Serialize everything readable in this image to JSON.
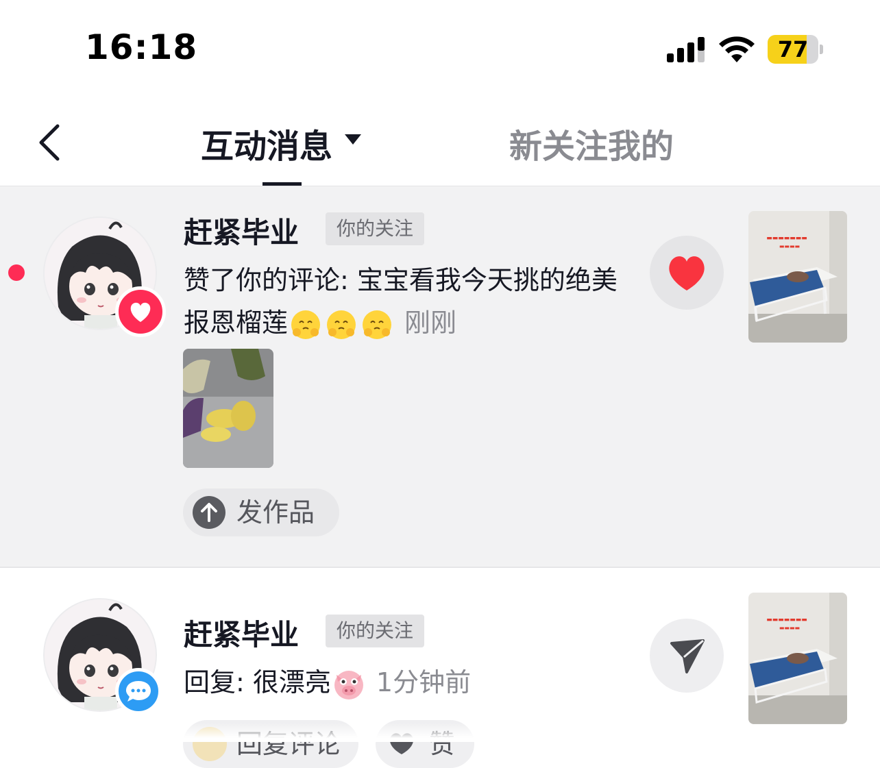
{
  "status": {
    "time": "16:18",
    "battery_level": "77",
    "battery_fraction": 0.77,
    "colors": {
      "battery_fill": "#f6d11a"
    }
  },
  "nav": {
    "back_icon": "chevron-left-icon",
    "tab_active": "互动消息",
    "tab_inactive": "新关注我的"
  },
  "notifications": [
    {
      "username": "赶紧毕业",
      "tag": "你的关注",
      "message": "赞了你的评论: 宝宝看我今天挑的绝美报恩榴莲",
      "emojis": [
        "hugging-face-emoji",
        "hugging-face-emoji",
        "hugging-face-emoji"
      ],
      "time": "刚刚",
      "badge_icon": "heart-icon",
      "action_icon": "heart-icon",
      "unread": true,
      "action_button": "发作品"
    },
    {
      "username": "赶紧毕业",
      "tag": "你的关注",
      "message": "回复: 很漂亮",
      "emojis": [
        "pig-face-emoji"
      ],
      "time": "1分钟前",
      "badge_icon": "chat-bubble-icon",
      "action_icon": "send-icon",
      "buttons": [
        "回复评论",
        "赞"
      ]
    }
  ],
  "colors": {
    "accent": "#fe2c55",
    "comment_blue": "#2d9cf4"
  }
}
